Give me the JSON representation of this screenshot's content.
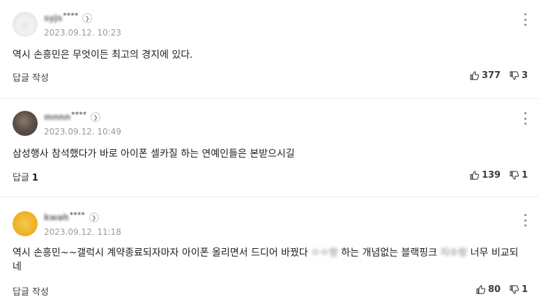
{
  "comments": [
    {
      "nickname": "syjs",
      "nickname_mask": "****",
      "date": "2023.09.12. 10:23",
      "text": "역시 손흥민은 무엇이든 최고의 경지에 있다.",
      "reply_label": "답글 작성",
      "reply_count": "",
      "likes": "377",
      "dislikes": "3",
      "avatar": "default-gray"
    },
    {
      "nickname": "mnnn",
      "nickname_mask": "****",
      "date": "2023.09.12. 10:49",
      "text": "삼성행사 참석했다가 바로 아이폰 셀카질 하는 연예인들은 본받으시길",
      "reply_label": "답글",
      "reply_count": "1",
      "likes": "139",
      "dislikes": "1",
      "avatar": "photo-dark"
    },
    {
      "nickname": "kwah",
      "nickname_mask": "****",
      "date": "2023.09.12. 11:18",
      "text_before": "역시 손흥민~~갤럭시 계약종료되자마자 아이폰 올리면서 드디어 바꿨다 ",
      "text_blur1": "ㅇㅇ랑",
      "text_middle": " 하는 개념없는 블랙핑크 ",
      "text_blur2": "지수랑",
      "text_after": " 너무 비교되네",
      "reply_label": "답글 작성",
      "reply_count": "",
      "likes": "80",
      "dislikes": "1",
      "avatar": "yellow"
    }
  ],
  "colors": {
    "text": "#1e1e23",
    "muted": "#9a9a9a",
    "divider": "#ebebeb"
  },
  "icons": {
    "like": "thumbs-up-icon",
    "dislike": "thumbs-down-icon",
    "more": "more-vertical-icon",
    "profile": "chevron-right-icon"
  }
}
